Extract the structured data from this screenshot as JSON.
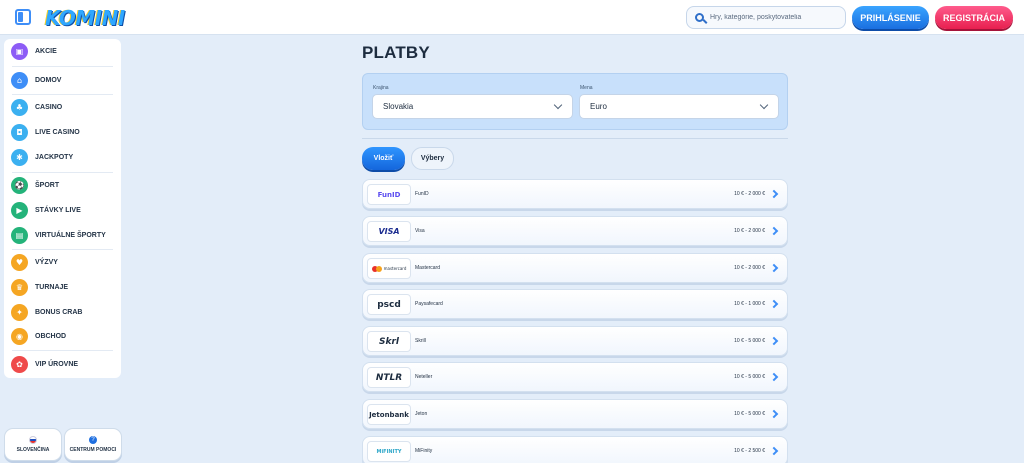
{
  "header": {
    "logo": "KOMINI",
    "search_placeholder": "Hry, kategórie, poskytovatelia",
    "login_label": "PRIHLÁSENIE",
    "register_label": "REGISTRÁCIA"
  },
  "sidebar": {
    "items": [
      {
        "label": "AKCIE",
        "icon": "gift-icon",
        "color": "#8d5cf6",
        "glyph": "▣"
      },
      {
        "label": "DOMOV",
        "icon": "home-icon",
        "color": "#3e8ef7",
        "glyph": "⌂"
      },
      {
        "label": "CASINO",
        "icon": "cherries-icon",
        "color": "#3bb0f0",
        "glyph": "♣"
      },
      {
        "label": "LIVE CASINO",
        "icon": "live-casino-icon",
        "color": "#3bb0f0",
        "glyph": "◘"
      },
      {
        "label": "JACKPOTY",
        "icon": "jackpot-icon",
        "color": "#3bb0f0",
        "glyph": "✱"
      },
      {
        "label": "ŠPORT",
        "icon": "football-icon",
        "color": "#24b37a",
        "glyph": "⚽"
      },
      {
        "label": "STÁVKY LIVE",
        "icon": "live-bets-icon",
        "color": "#24b37a",
        "glyph": "▶"
      },
      {
        "label": "VIRTUÁLNE ŠPORTY",
        "icon": "virtual-sports-icon",
        "color": "#24b37a",
        "glyph": "▤"
      },
      {
        "label": "VÝZVY",
        "icon": "challenges-icon",
        "color": "#f5a623",
        "glyph": "♥"
      },
      {
        "label": "TURNAJE",
        "icon": "trophy-icon",
        "color": "#f5a623",
        "glyph": "♛"
      },
      {
        "label": "BONUS CRAB",
        "icon": "bonus-crab-icon",
        "color": "#f5a623",
        "glyph": "✦"
      },
      {
        "label": "OBCHOD",
        "icon": "shop-icon",
        "color": "#f5a623",
        "glyph": "◉"
      },
      {
        "label": "VIP ÚROVNE",
        "icon": "vip-icon",
        "color": "#ef4a4a",
        "glyph": "✿"
      }
    ],
    "language_label": "SLOVENČINA",
    "help_label": "CENTRUM POMOCI"
  },
  "main": {
    "title": "PLATBY",
    "country_label": "Krajina",
    "country_value": "Slovakia",
    "currency_label": "Mena",
    "currency_value": "Euro",
    "tab_deposit": "Vložiť",
    "tab_withdraw": "Výbery",
    "methods": [
      {
        "logo": "FunID",
        "name": "FunID",
        "range": "10 € - 2 000 €",
        "color": "#5b4cf0"
      },
      {
        "logo": "VISA",
        "name": "Visa",
        "range": "10 € - 2 000 €",
        "color": "#1a2b8f"
      },
      {
        "logo": "mastercard",
        "name": "Mastercard",
        "range": "10 € - 2 000 €",
        "color": "#e8302a"
      },
      {
        "logo": "pscd",
        "name": "Paysafecard",
        "range": "10 € - 1 000 €",
        "color": "#1d2c3f"
      },
      {
        "logo": "Skrl",
        "name": "Skrill",
        "range": "10 € - 5 000 €",
        "color": "#1d2c3f"
      },
      {
        "logo": "NTLR",
        "name": "Neteller",
        "range": "10 € - 5 000 €",
        "color": "#1d2c3f"
      },
      {
        "logo": "Jetonbank",
        "name": "Jeton",
        "range": "10 € - 5 000 €",
        "color": "#1d2c3f"
      },
      {
        "logo": "MiFINITY",
        "name": "MiFinity",
        "range": "10 € - 2 500 €",
        "color": "#2fa7c9"
      }
    ]
  }
}
